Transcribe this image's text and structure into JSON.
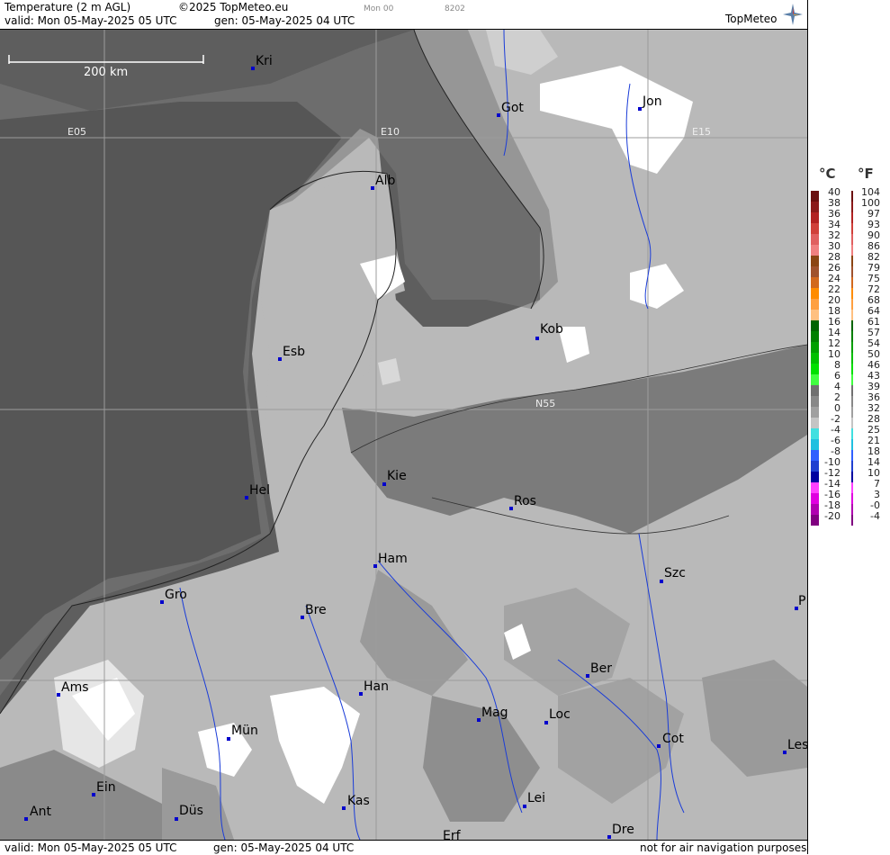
{
  "header": {
    "product": "Temperature (2 m AGL)",
    "copyright": "©2025 TopMeteo.eu",
    "valid": "valid:  Mon  05-May-2025  05 UTC",
    "gen": "gen: 05-May-2025 04 UTC",
    "run_small": "Mon 00",
    "code_small": "8202",
    "logo": "TopMeteo"
  },
  "footer": {
    "valid": "valid:  Mon  05-May-2025  05 UTC",
    "gen": "gen: 05-May-2025 04 UTC",
    "disclaimer": "not for air navigation purposes"
  },
  "map": {
    "scale_label": "200 km",
    "grid_labels": {
      "e05": "E05",
      "e10": "E10",
      "e15": "E15",
      "n55": "N55"
    },
    "cities": [
      {
        "name": "Kri"
      },
      {
        "name": "Got"
      },
      {
        "name": "Jon"
      },
      {
        "name": "Alb"
      },
      {
        "name": "Kob"
      },
      {
        "name": "Esb"
      },
      {
        "name": "Kie"
      },
      {
        "name": "Ros"
      },
      {
        "name": "Hel"
      },
      {
        "name": "Ham"
      },
      {
        "name": "Szc"
      },
      {
        "name": "Gro"
      },
      {
        "name": "Bre"
      },
      {
        "name": "P"
      },
      {
        "name": "Ber"
      },
      {
        "name": "Ams"
      },
      {
        "name": "Han"
      },
      {
        "name": "Loc"
      },
      {
        "name": "Mag"
      },
      {
        "name": "Cot"
      },
      {
        "name": "Les"
      },
      {
        "name": "Mün"
      },
      {
        "name": "Ein"
      },
      {
        "name": "Kas"
      },
      {
        "name": "Lei"
      },
      {
        "name": "Ant"
      },
      {
        "name": "Düs"
      },
      {
        "name": "Dre"
      },
      {
        "name": "Erf"
      }
    ]
  },
  "legend": {
    "unit_c": "°C",
    "unit_f": "°F",
    "celsius": [
      "40",
      "38",
      "36",
      "34",
      "32",
      "30",
      "28",
      "26",
      "24",
      "22",
      "20",
      "18",
      "16",
      "14",
      "12",
      "10",
      "8",
      "6",
      "4",
      "2",
      "0",
      "-2",
      "-4",
      "-6",
      "-8",
      "-10",
      "-12",
      "-14",
      "-16",
      "-18",
      "-20"
    ],
    "fahrenheit": [
      "104",
      "100",
      "97",
      "93",
      "90",
      "86",
      "82",
      "79",
      "75",
      "72",
      "68",
      "64",
      "61",
      "57",
      "54",
      "50",
      "46",
      "43",
      "39",
      "36",
      "32",
      "28",
      "25",
      "21",
      "18",
      "14",
      "10",
      "7",
      "3",
      "-0",
      "-4"
    ],
    "colors": [
      "#6b0f0f",
      "#8b1a1a",
      "#b22222",
      "#d0403a",
      "#e06060",
      "#f08080",
      "#8b4513",
      "#a0522d",
      "#d2691e",
      "#ff8c00",
      "#ffa040",
      "#ffc080",
      "#006400",
      "#008000",
      "#00a000",
      "#00c000",
      "#00e000",
      "#40ff40",
      "#707070",
      "#888888",
      "#a0a0a0",
      "#c4c4c4",
      "#40e0e0",
      "#20c0e0",
      "#3060ff",
      "#2040d0",
      "#0000a0",
      "#ff40ff",
      "#e000e0",
      "#b000b0",
      "#800080"
    ]
  }
}
